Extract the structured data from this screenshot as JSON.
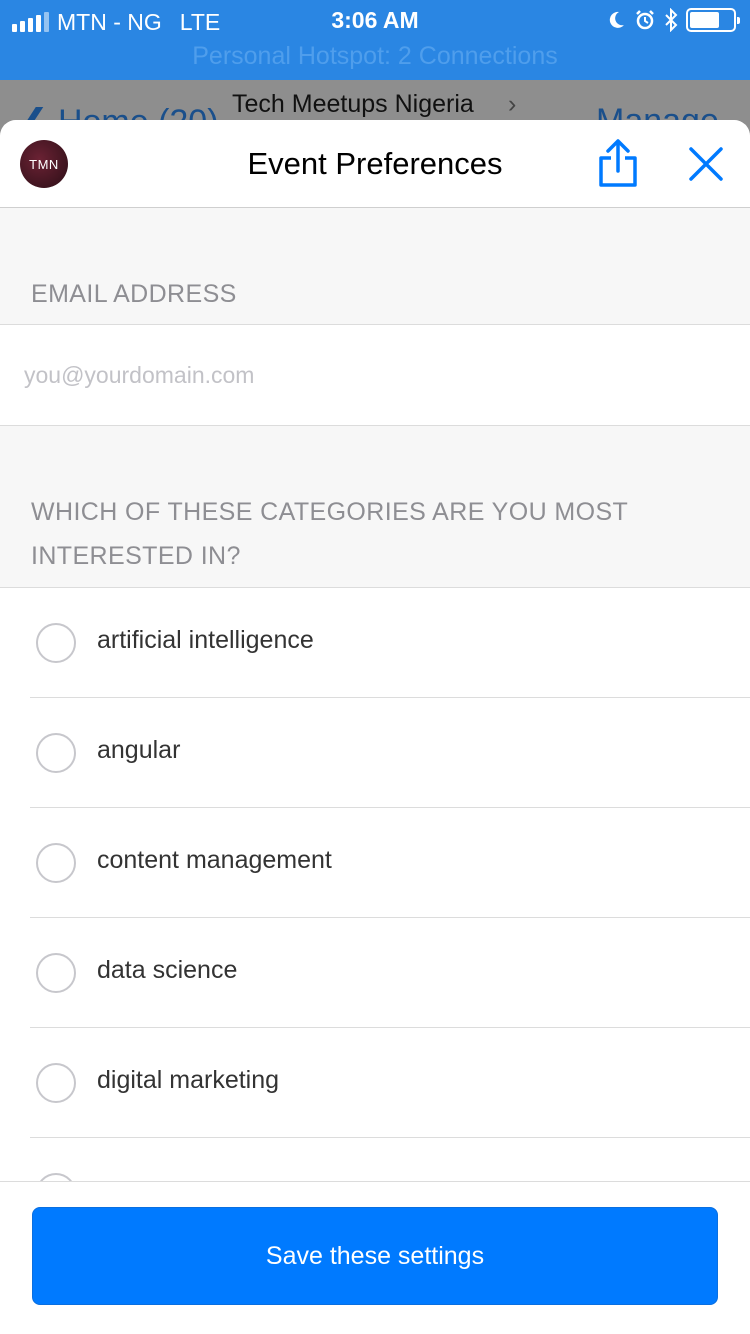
{
  "status_bar": {
    "carrier": "MTN - NG",
    "network": "LTE",
    "time": "3:06 AM",
    "hotspot": "Personal Hotspot: 2 Connections",
    "icons": [
      "moon-icon",
      "alarm-icon",
      "bluetooth-icon",
      "battery-icon"
    ],
    "battery_level": 0.7
  },
  "underlay": {
    "back_label": "Home (20)",
    "title": "Tech Meetups Nigeria",
    "manage_label": "Manage"
  },
  "sheet": {
    "logo_text": "TMN",
    "title": "Event Preferences"
  },
  "email": {
    "label": "EMAIL ADDRESS",
    "value": "",
    "placeholder": "you@yourdomain.com"
  },
  "categories": {
    "label": "WHICH OF THESE CATEGORIES ARE YOU MOST INTERESTED IN?",
    "options": [
      {
        "label": "artificial intelligence"
      },
      {
        "label": "angular"
      },
      {
        "label": "content management"
      },
      {
        "label": "data science"
      },
      {
        "label": "digital marketing"
      }
    ]
  },
  "footer": {
    "save_label": "Save these settings"
  },
  "colors": {
    "accent": "#007aff",
    "status_bar": "#2a86e3"
  }
}
